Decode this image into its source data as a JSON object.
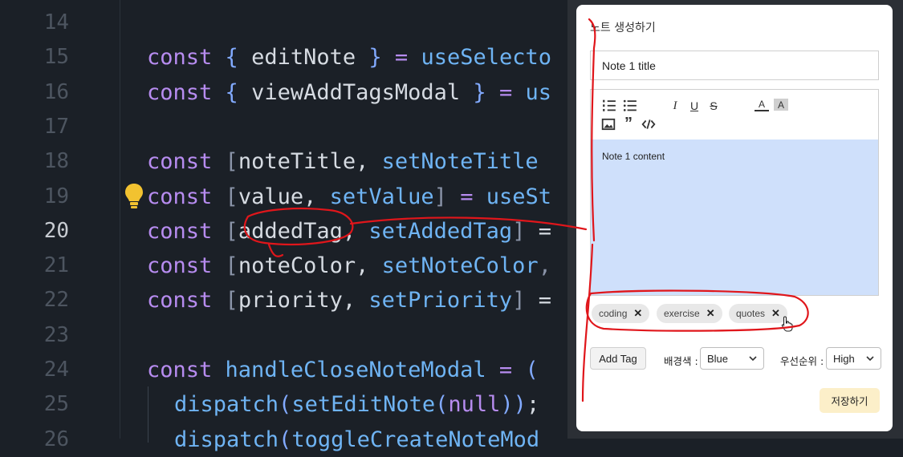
{
  "editor": {
    "lines": [
      {
        "n": "14",
        "tokens": []
      },
      {
        "n": "15",
        "tokens": [
          [
            "kw",
            "const"
          ],
          [
            "tx",
            " "
          ],
          [
            "bl",
            "{"
          ],
          [
            "tx",
            " editNote "
          ],
          [
            "bl",
            "}"
          ],
          [
            "tx",
            " "
          ],
          [
            "kw",
            "="
          ],
          [
            "tx",
            " "
          ],
          [
            "fn",
            "useSelecto"
          ]
        ]
      },
      {
        "n": "16",
        "tokens": [
          [
            "kw",
            "const"
          ],
          [
            "tx",
            " "
          ],
          [
            "bl",
            "{"
          ],
          [
            "tx",
            " viewAddTagsModal "
          ],
          [
            "bl",
            "}"
          ],
          [
            "tx",
            " "
          ],
          [
            "kw",
            "="
          ],
          [
            "tx",
            " "
          ],
          [
            "fn",
            "us"
          ]
        ]
      },
      {
        "n": "17",
        "tokens": []
      },
      {
        "n": "18",
        "tokens": [
          [
            "kw",
            "const"
          ],
          [
            "tx",
            " "
          ],
          [
            "dim",
            "["
          ],
          [
            "tx",
            "noteTitle, "
          ],
          [
            "fn",
            "setNoteTitle"
          ]
        ]
      },
      {
        "n": "19",
        "tokens": [
          [
            "kw",
            "const"
          ],
          [
            "tx",
            " "
          ],
          [
            "dim",
            "["
          ],
          [
            "tx",
            "value, "
          ],
          [
            "fn",
            "setValue"
          ],
          [
            "dim",
            "]"
          ],
          [
            "tx",
            " "
          ],
          [
            "kw",
            "="
          ],
          [
            "tx",
            " "
          ],
          [
            "fn",
            "useSt"
          ]
        ]
      },
      {
        "n": "20",
        "tokens": [
          [
            "kw",
            "const"
          ],
          [
            "tx",
            " "
          ],
          [
            "dim",
            "["
          ],
          [
            "tx",
            "addedTag, "
          ],
          [
            "fn",
            "setAddedTag"
          ],
          [
            "dim",
            "]"
          ],
          [
            "tx",
            " ="
          ]
        ]
      },
      {
        "n": "21",
        "tokens": [
          [
            "kw",
            "const"
          ],
          [
            "tx",
            " "
          ],
          [
            "dim",
            "["
          ],
          [
            "tx",
            "noteColor, "
          ],
          [
            "fn",
            "setNoteColor"
          ],
          [
            "dim",
            ","
          ]
        ]
      },
      {
        "n": "22",
        "tokens": [
          [
            "kw",
            "const"
          ],
          [
            "tx",
            " "
          ],
          [
            "dim",
            "["
          ],
          [
            "tx",
            "priority, "
          ],
          [
            "fn",
            "setPriority"
          ],
          [
            "dim",
            "]"
          ],
          [
            "tx",
            " ="
          ]
        ]
      },
      {
        "n": "23",
        "tokens": []
      },
      {
        "n": "24",
        "tokens": [
          [
            "kw",
            "const"
          ],
          [
            "tx",
            " "
          ],
          [
            "fn",
            "handleCloseNoteModal"
          ],
          [
            "tx",
            " "
          ],
          [
            "kw",
            "="
          ],
          [
            "tx",
            " "
          ],
          [
            "bl",
            "("
          ]
        ]
      },
      {
        "n": "25",
        "indent": true,
        "tokens": [
          [
            "fn",
            "dispatch"
          ],
          [
            "bl",
            "("
          ],
          [
            "fn",
            "setEditNote"
          ],
          [
            "bl",
            "("
          ],
          [
            "kw",
            "null"
          ],
          [
            "bl",
            "))"
          ],
          [
            "tx",
            ";"
          ]
        ]
      },
      {
        "n": "26",
        "indent": true,
        "tokens": [
          [
            "fn",
            "dispatch"
          ],
          [
            "bl",
            "("
          ],
          [
            "fn",
            "toggleCreateNoteMod"
          ]
        ]
      }
    ],
    "active_line": "20"
  },
  "modal": {
    "title": "노트 생성하기",
    "title_input_value": "Note 1 title",
    "content": "Note 1 content",
    "toolbar": [
      "ordered-list-icon",
      "bullet-list-icon",
      "italic-icon",
      "underline-icon",
      "strikethrough-icon",
      "font-color-icon",
      "background-color-icon",
      "image-icon",
      "quote-icon",
      "code-icon"
    ],
    "tags": [
      {
        "label": "coding"
      },
      {
        "label": "exercise"
      },
      {
        "label": "quotes"
      }
    ],
    "add_tag_label": "Add Tag",
    "color_label": "배경색 :",
    "color_value": "Blue",
    "priority_label": "우선순위 :",
    "priority_value": "High",
    "save_label": "저장하기"
  },
  "colors": {
    "editor_bg": "#1b2027",
    "keyword": "#b78cf0",
    "function": "#6fb4f4",
    "note_bg": "#cfe0fb",
    "save_bg": "#fcefc9",
    "annotation": "#e0161b"
  }
}
